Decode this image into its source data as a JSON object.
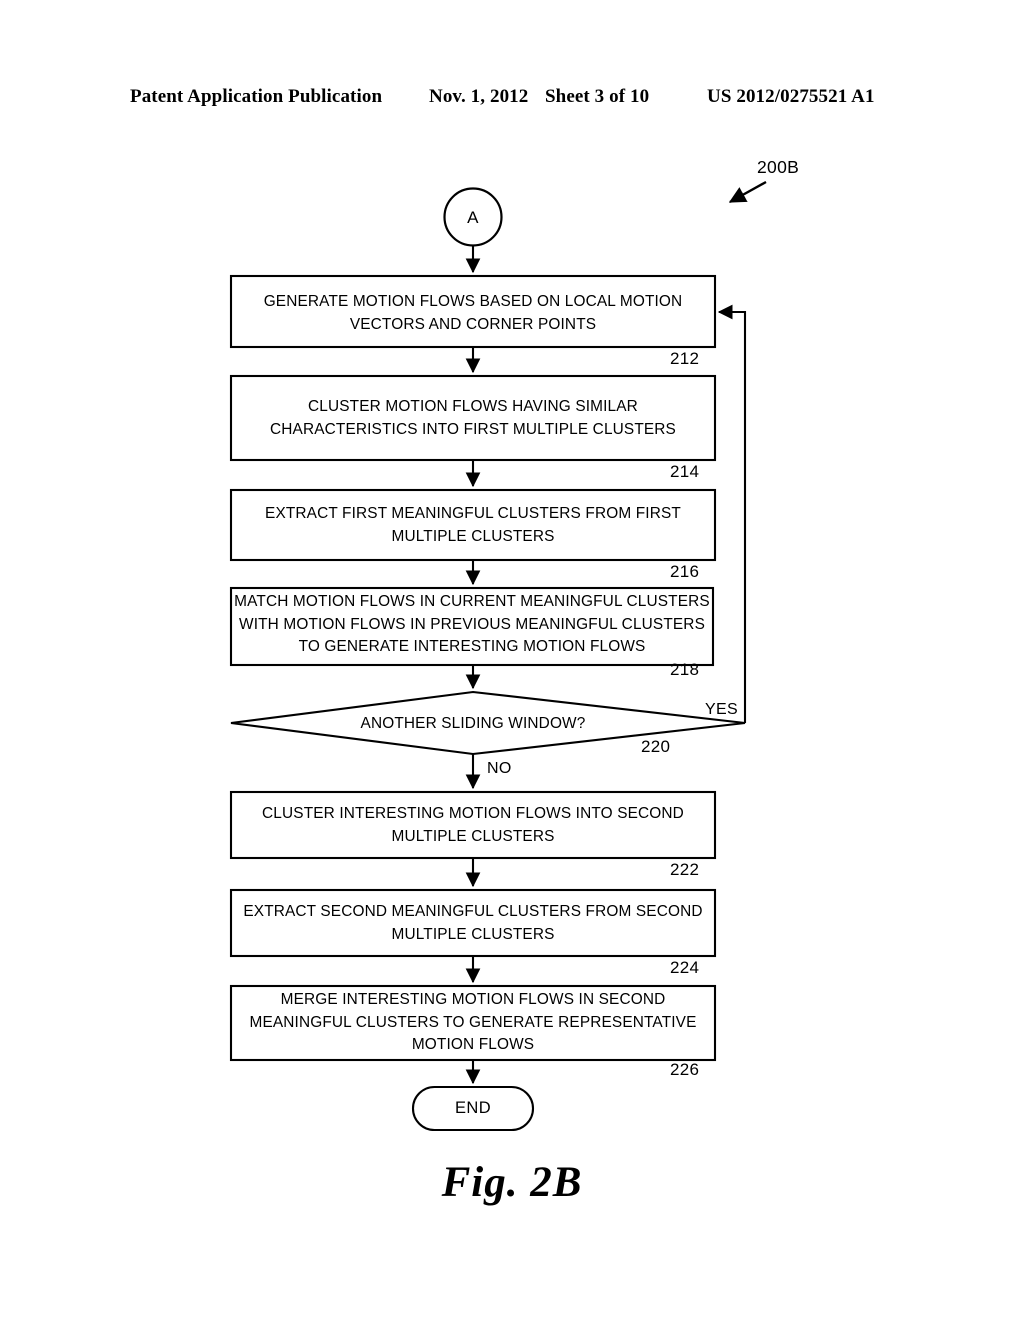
{
  "header": {
    "publication": "Patent Application Publication",
    "date": "Nov. 1, 2012",
    "sheet": "Sheet 3 of 10",
    "patent_number": "US 2012/0275521 A1"
  },
  "figure": {
    "caption": "Fig. 2B",
    "diagram_tag": "200B",
    "entry_connector": "A",
    "terminator_end": "END"
  },
  "flowchart": {
    "type": "flowchart",
    "nodes": [
      {
        "id": "entry",
        "shape": "circle",
        "label": "A"
      },
      {
        "id": "s212",
        "shape": "process",
        "ref": "212",
        "label": "GENERATE MOTION FLOWS BASED ON LOCAL MOTION\nVECTORS AND CORNER POINTS"
      },
      {
        "id": "s214",
        "shape": "process",
        "ref": "214",
        "label": "CLUSTER MOTION FLOWS HAVING SIMILAR\nCHARACTERISTICS INTO FIRST MULTIPLE CLUSTERS"
      },
      {
        "id": "s216",
        "shape": "process",
        "ref": "216",
        "label": "EXTRACT FIRST MEANINGFUL CLUSTERS FROM FIRST\nMULTIPLE CLUSTERS"
      },
      {
        "id": "s218",
        "shape": "process",
        "ref": "218",
        "label": "MATCH MOTION FLOWS IN CURRENT MEANINGFUL CLUSTERS\nWITH MOTION FLOWS IN PREVIOUS MEANINGFUL CLUSTERS\nTO GENERATE INTERESTING MOTION FLOWS"
      },
      {
        "id": "d220",
        "shape": "decision",
        "ref": "220",
        "label": "ANOTHER SLIDING WINDOW?"
      },
      {
        "id": "s222",
        "shape": "process",
        "ref": "222",
        "label": "CLUSTER INTERESTING MOTION FLOWS INTO SECOND\nMULTIPLE CLUSTERS"
      },
      {
        "id": "s224",
        "shape": "process",
        "ref": "224",
        "label": "EXTRACT SECOND MEANINGFUL CLUSTERS FROM SECOND\nMULTIPLE CLUSTERS"
      },
      {
        "id": "s226",
        "shape": "process",
        "ref": "226",
        "label": "MERGE INTERESTING MOTION FLOWS IN SECOND\nMEANINGFUL CLUSTERS TO GENERATE REPRESENTATIVE\nMOTION FLOWS"
      },
      {
        "id": "end",
        "shape": "terminator",
        "label": "END"
      }
    ],
    "edges": [
      {
        "from": "entry",
        "to": "s212",
        "label": ""
      },
      {
        "from": "s212",
        "to": "s214",
        "label": ""
      },
      {
        "from": "s214",
        "to": "s216",
        "label": ""
      },
      {
        "from": "s216",
        "to": "s218",
        "label": ""
      },
      {
        "from": "s218",
        "to": "d220",
        "label": ""
      },
      {
        "from": "d220",
        "to": "s212",
        "label": "YES"
      },
      {
        "from": "d220",
        "to": "s222",
        "label": "NO"
      },
      {
        "from": "s222",
        "to": "s224",
        "label": ""
      },
      {
        "from": "s224",
        "to": "s226",
        "label": ""
      },
      {
        "from": "s226",
        "to": "end",
        "label": ""
      }
    ],
    "labels": {
      "yes": "YES",
      "no": "NO"
    }
  },
  "colors": {
    "ink": "#000000",
    "paper": "#ffffff"
  }
}
